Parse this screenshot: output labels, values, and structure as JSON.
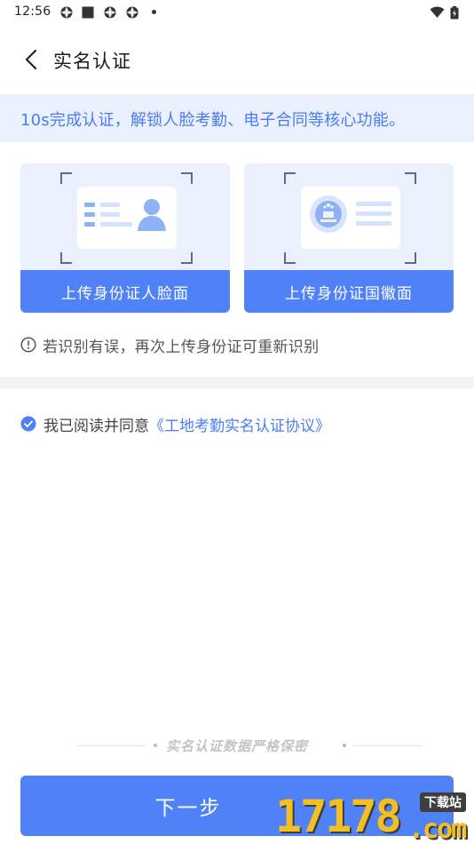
{
  "status_bar": {
    "time": "12:56",
    "icons": [
      "notification-icon",
      "stop-icon",
      "notification-icon",
      "notification-icon",
      "dot-icon"
    ],
    "right_icons": [
      "wifi-icon",
      "battery-icon"
    ]
  },
  "header": {
    "title": "实名认证",
    "back_icon": "chevron-left-icon"
  },
  "tip_banner": {
    "text": "10s完成认证，解锁人脸考勤、电子合同等核心功能。"
  },
  "upload_cards": [
    {
      "label": "上传身份证人脸面",
      "illustration": "id-card-face-icon"
    },
    {
      "label": "上传身份证国徽面",
      "illustration": "id-card-emblem-icon"
    }
  ],
  "hint": {
    "icon": "info-icon",
    "text": "若识别有误，再次上传身份证可重新识别"
  },
  "agreement": {
    "checked": true,
    "prefix": "我已阅读并同意",
    "link": "《工地考勤实名认证协议》"
  },
  "secure_note": "实名认证数据严格保密",
  "next_button": "下一步",
  "watermark": {
    "digits": "17178",
    "suffix": ".com",
    "badge": "下载站"
  },
  "colors": {
    "accent": "#4f82f6",
    "banner_bg": "#eaf0fd",
    "card_bg": "#ebf1fc",
    "link": "#4a7cf3"
  }
}
